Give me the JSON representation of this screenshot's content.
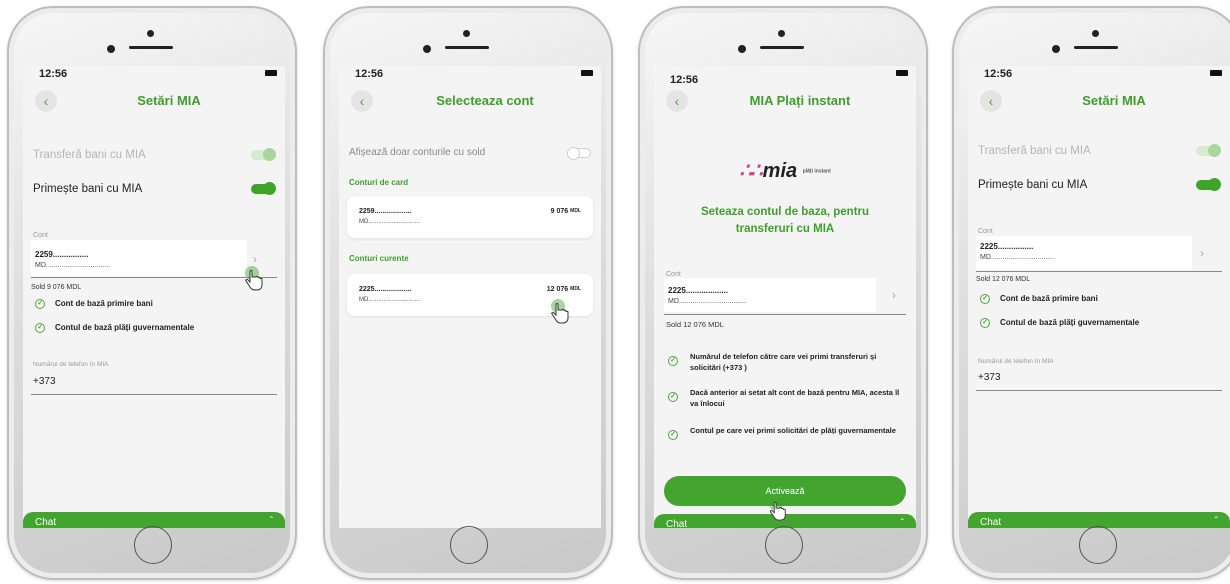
{
  "colors": {
    "brand_green": "#43a52f",
    "title_green": "#3f9e2c",
    "logo_pink": "#c04a8b"
  },
  "screens": [
    {
      "time": "12:56",
      "title": "Setări MIA",
      "toggles": [
        {
          "label": "Transferă bani cu MIA",
          "state": "disabled-on"
        },
        {
          "label": "Primește bani cu MIA",
          "state": "on"
        }
      ],
      "account": {
        "label": "Cont",
        "number": "2259................",
        "md": "MD.................................",
        "sold": "Sold 9 076 MDL"
      },
      "checks": [
        "Cont de bază primire bani",
        "Contul de bază plăți guvernamentale"
      ],
      "phone": {
        "label": "Numărul de telefon în MIA",
        "value": "+373"
      },
      "chat": "Chat"
    },
    {
      "time": "12:56",
      "title": "Selecteaza cont",
      "toggle": {
        "label": "Afișează doar conturile cu sold",
        "state": "off"
      },
      "card_section": "Conturi de card",
      "card_account": {
        "number": "2259...................",
        "md": "MD...............................",
        "balance": "9 076",
        "currency": "MDL"
      },
      "current_section": "Conturi curente",
      "current_account": {
        "number": "2225...................",
        "md": "MD...............................",
        "balance": "12 076",
        "currency": "MDL"
      }
    },
    {
      "time": "12:56",
      "title": "MIA Plați instant",
      "logo": {
        "dots": "∴∴",
        "text": "mia",
        "sub": "plăți instant"
      },
      "headline": "Seteaza contul de baza, pentru transferuri cu MIA",
      "account": {
        "label": "Cont",
        "number": "2225...................",
        "md": "MD...................................",
        "sold": "Sold 12 076 MDL"
      },
      "info": [
        "Numărul de telefon către care vei primi transferuri și solicitări (+373                )",
        "Dacă anterior ai setat alt cont de bază pentru MIA, acesta îl va înlocui",
        "Contul pe care vei primi solicitări de plăți guvernamentale"
      ],
      "activate": "Activează",
      "chat": "Chat"
    },
    {
      "time": "12:56",
      "title": "Setări MIA",
      "toggles": [
        {
          "label": "Transferă bani cu MIA",
          "state": "disabled-on"
        },
        {
          "label": "Primește bani cu MIA",
          "state": "on"
        }
      ],
      "account": {
        "label": "Cont",
        "number": "2225................",
        "md": "MD.................................",
        "sold": "Sold 12 076 MDL"
      },
      "checks": [
        "Cont de bază primire bani",
        "Contul de bază plăți guvernamentale"
      ],
      "phone": {
        "label": "Numărul de telefon în MIA",
        "value": "+373"
      },
      "chat": "Chat"
    }
  ]
}
